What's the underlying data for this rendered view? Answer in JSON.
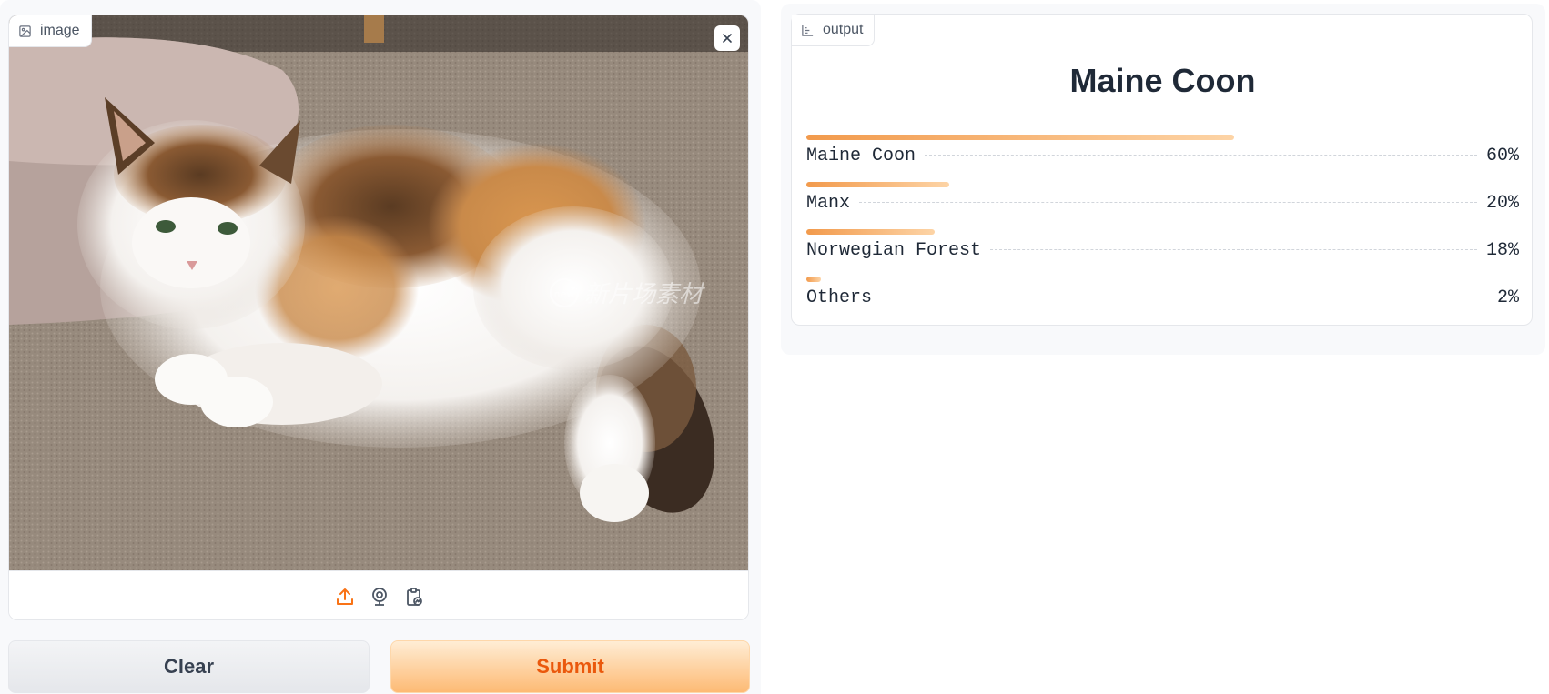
{
  "input": {
    "label": "image",
    "label_icon": "image-icon",
    "close_icon": "close-icon",
    "watermark": "新片场素材",
    "watermark_badge": "new",
    "sources": [
      {
        "name": "upload",
        "icon": "upload-icon"
      },
      {
        "name": "webcam",
        "icon": "webcam-icon"
      },
      {
        "name": "clipboard",
        "icon": "clipboard-icon"
      }
    ]
  },
  "buttons": {
    "clear": "Clear",
    "submit": "Submit"
  },
  "output": {
    "label": "output",
    "label_icon": "bar-chart-icon",
    "title": "Maine Coon",
    "confidences": [
      {
        "label": "Maine Coon",
        "percent_text": "60%",
        "value": 0.6
      },
      {
        "label": "Manx",
        "percent_text": "20%",
        "value": 0.2
      },
      {
        "label": "Norwegian Forest",
        "percent_text": "18%",
        "value": 0.18
      },
      {
        "label": "Others",
        "percent_text": "2%",
        "value": 0.02
      }
    ]
  },
  "colors": {
    "accent": "#f97316",
    "submit_text": "#ea580c",
    "bar_start": "#f29a4c",
    "bar_end": "#fdd4a6"
  }
}
